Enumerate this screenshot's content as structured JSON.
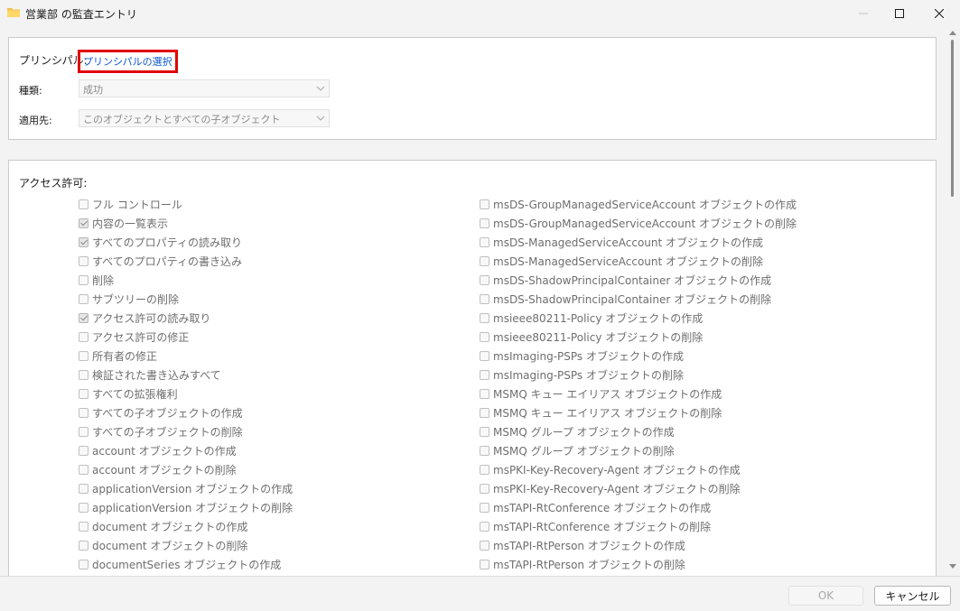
{
  "window": {
    "title": "営業部 の監査エントリ",
    "icon": "folder-icon"
  },
  "principal": {
    "label": "プリンシパル:",
    "link": "プリンシパルの選択"
  },
  "type": {
    "label": "種類:",
    "value": "成功"
  },
  "applies_to": {
    "label": "適用先:",
    "value": "このオブジェクトとすべての子オブジェクト"
  },
  "permissions": {
    "title": "アクセス許可:",
    "left": [
      {
        "label": "フル コントロール",
        "checked": false
      },
      {
        "label": "内容の一覧表示",
        "checked": true
      },
      {
        "label": "すべてのプロパティの読み取り",
        "checked": true
      },
      {
        "label": "すべてのプロパティの書き込み",
        "checked": false
      },
      {
        "label": "削除",
        "checked": false
      },
      {
        "label": "サブツリーの削除",
        "checked": false
      },
      {
        "label": "アクセス許可の読み取り",
        "checked": true
      },
      {
        "label": "アクセス許可の修正",
        "checked": false
      },
      {
        "label": "所有者の修正",
        "checked": false
      },
      {
        "label": "検証された書き込みすべて",
        "checked": false
      },
      {
        "label": "すべての拡張権利",
        "checked": false
      },
      {
        "label": "すべての子オブジェクトの作成",
        "checked": false
      },
      {
        "label": "すべての子オブジェクトの削除",
        "checked": false
      },
      {
        "label": "account オブジェクトの作成",
        "checked": false
      },
      {
        "label": "account オブジェクトの削除",
        "checked": false
      },
      {
        "label": "applicationVersion オブジェクトの作成",
        "checked": false
      },
      {
        "label": "applicationVersion オブジェクトの削除",
        "checked": false
      },
      {
        "label": "document オブジェクトの作成",
        "checked": false
      },
      {
        "label": "document オブジェクトの削除",
        "checked": false
      },
      {
        "label": "documentSeries オブジェクトの作成",
        "checked": false
      }
    ],
    "right": [
      {
        "label": "msDS-GroupManagedServiceAccount オブジェクトの作成",
        "checked": false
      },
      {
        "label": "msDS-GroupManagedServiceAccount オブジェクトの削除",
        "checked": false
      },
      {
        "label": "msDS-ManagedServiceAccount オブジェクトの作成",
        "checked": false
      },
      {
        "label": "msDS-ManagedServiceAccount オブジェクトの削除",
        "checked": false
      },
      {
        "label": "msDS-ShadowPrincipalContainer オブジェクトの作成",
        "checked": false
      },
      {
        "label": "msDS-ShadowPrincipalContainer オブジェクトの削除",
        "checked": false
      },
      {
        "label": "msieee80211-Policy オブジェクトの作成",
        "checked": false
      },
      {
        "label": "msieee80211-Policy オブジェクトの削除",
        "checked": false
      },
      {
        "label": "msImaging-PSPs オブジェクトの作成",
        "checked": false
      },
      {
        "label": "msImaging-PSPs オブジェクトの削除",
        "checked": false
      },
      {
        "label": "MSMQ キュー エイリアス オブジェクトの作成",
        "checked": false
      },
      {
        "label": "MSMQ キュー エイリアス オブジェクトの削除",
        "checked": false
      },
      {
        "label": "MSMQ グループ オブジェクトの作成",
        "checked": false
      },
      {
        "label": "MSMQ グループ オブジェクトの削除",
        "checked": false
      },
      {
        "label": "msPKI-Key-Recovery-Agent オブジェクトの作成",
        "checked": false
      },
      {
        "label": "msPKI-Key-Recovery-Agent オブジェクトの削除",
        "checked": false
      },
      {
        "label": "msTAPI-RtConference オブジェクトの作成",
        "checked": false
      },
      {
        "label": "msTAPI-RtConference オブジェクトの削除",
        "checked": false
      },
      {
        "label": "msTAPI-RtPerson オブジェクトの作成",
        "checked": false
      },
      {
        "label": "msTAPI-RtPerson オブジェクトの削除",
        "checked": false
      }
    ]
  },
  "footer": {
    "ok": "OK",
    "cancel": "キャンセル"
  },
  "colors": {
    "link": "#0b57d0",
    "highlight_border": "#e00000"
  }
}
